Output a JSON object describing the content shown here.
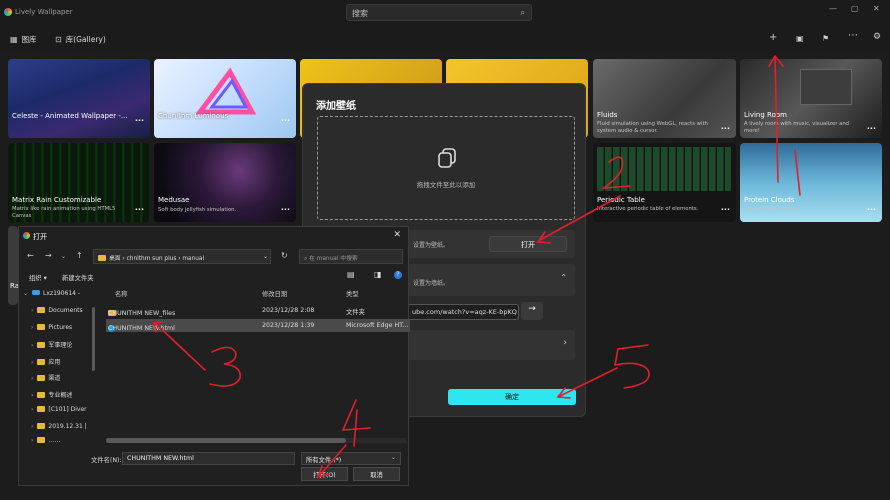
{
  "app": {
    "title": "Lively Wallpaper",
    "search_placeholder": "搜索"
  },
  "nav": {
    "tab_library": "图库",
    "tab_gallery": "库(Gallery)"
  },
  "cards": [
    {
      "title": "Celeste - Animated Wallpaper -...",
      "subtitle": ""
    },
    {
      "title": "Chunithm Luminous",
      "subtitle": ""
    },
    {
      "title": "",
      "subtitle": ""
    },
    {
      "title": "",
      "subtitle": ""
    },
    {
      "title": "Fluids",
      "subtitle": "Fluid simulation using WebGL, reacts with system audio & cursor."
    },
    {
      "title": "Living Room",
      "subtitle": "A lively room with music, visualizer and more!"
    },
    {
      "title": "Matrix Rain Customizable",
      "subtitle": "Matrix like rain animation using HTML5 Canvas"
    },
    {
      "title": "Medusae",
      "subtitle": "Soft body jellyfish simulation."
    },
    {
      "title": "Periodic Table",
      "subtitle": "Interactive periodic table of elements."
    },
    {
      "title": "Protein Clouds",
      "subtitle": "Customisable clouds"
    }
  ],
  "card_partial": {
    "left_label": "Ra"
  },
  "add_dialog": {
    "title": "添加壁纸",
    "drop_hint": "拖拽文件至此以添加",
    "file_section_text": "设置为壁纸。",
    "open_button": "打开",
    "url_section_text": "设置为墙纸。",
    "url_value": "ube.com/watch?v=aqz-KE-bpKQ",
    "go_arrow": "→",
    "confirm_button": "确定"
  },
  "file_dialog": {
    "title": "打开",
    "address": "桌面 › chnithm sun plus › manual",
    "search_placeholder": "在 manual 中搜索",
    "organize": "组织 ▾",
    "new_folder": "新建文件夹",
    "columns": {
      "name": "名称",
      "date": "修改日期",
      "type": "类型"
    },
    "files": [
      {
        "name": "CHUNITHM NEW_files",
        "date": "2023/12/28 2:08",
        "type": "文件夹",
        "kind": "folder"
      },
      {
        "name": "CHUNITHM NEW.html",
        "date": "2023/12/28 1:39",
        "type": "Microsoft Edge HT...",
        "kind": "html"
      }
    ],
    "tree": [
      "Lxz190614 -",
      "Documents",
      "Pictures",
      "军事理论",
      "应用",
      "渠道",
      "专业概述",
      "[C101] Diver",
      "2019.12.31 |",
      "……"
    ],
    "filename_label": "文件名(N):",
    "filename_value": "CHUNITHM NEW.html",
    "filetype_value": "所有文件 (*)",
    "open_button": "打开(O)",
    "cancel_button": "取消"
  },
  "annotations": [
    "1",
    "2",
    "3",
    "4",
    "5"
  ]
}
